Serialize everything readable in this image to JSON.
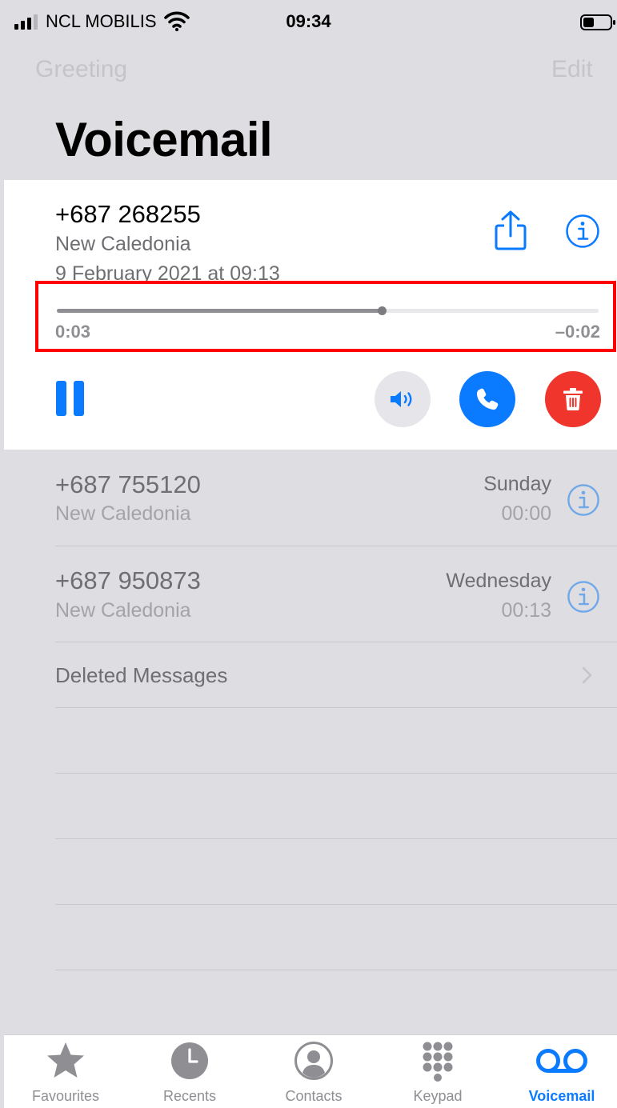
{
  "status_bar": {
    "carrier": "NCL MOBILIS",
    "time": "09:34"
  },
  "nav": {
    "left_label": "Greeting",
    "right_label": "Edit",
    "title": "Voicemail"
  },
  "expanded_message": {
    "number": "+687 268255",
    "location": "New Caledonia",
    "date": "9 February 2021 at 09:13",
    "playback": {
      "elapsed": "0:03",
      "remaining": "–0:02",
      "progress_fraction": 0.6
    }
  },
  "messages": [
    {
      "number": "+687 755120",
      "location": "New Caledonia",
      "day": "Sunday",
      "time": "00:00"
    },
    {
      "number": "+687 950873",
      "location": "New Caledonia",
      "day": "Wednesday",
      "time": "00:13"
    }
  ],
  "deleted_messages_label": "Deleted Messages",
  "tabs": [
    {
      "label": "Favourites",
      "icon": "star-icon",
      "active": false
    },
    {
      "label": "Recents",
      "icon": "clock-icon",
      "active": false
    },
    {
      "label": "Contacts",
      "icon": "person-circle-icon",
      "active": false
    },
    {
      "label": "Keypad",
      "icon": "keypad-icon",
      "active": false
    },
    {
      "label": "Voicemail",
      "icon": "voicemail-icon",
      "active": true
    }
  ],
  "colors": {
    "accent": "#0a7aff",
    "delete": "#f0352d",
    "highlight": "#ff0000"
  }
}
